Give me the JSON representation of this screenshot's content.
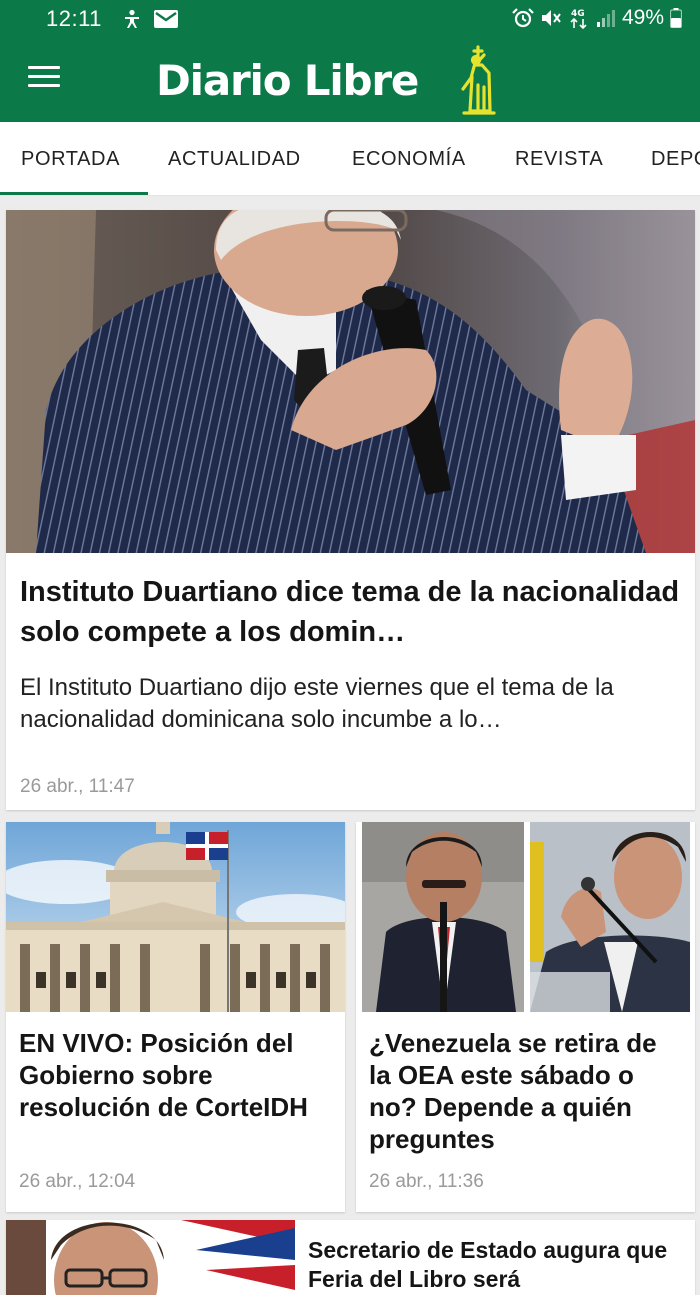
{
  "status_bar": {
    "time": "12:11",
    "battery": "49%",
    "network": "4G",
    "left_icons": [
      "accessibility-icon",
      "gmail-icon"
    ],
    "right_icons": [
      "alarm-icon",
      "mute-icon",
      "network-4g-icon",
      "signal-icon",
      "battery-icon"
    ]
  },
  "app_bar": {
    "brand": "Diario Libre",
    "brand_color": "#0c7a48",
    "accent": "#e6e32e"
  },
  "tabs": [
    {
      "label": "PORTADA",
      "active": true
    },
    {
      "label": "ACTUALIDAD",
      "active": false
    },
    {
      "label": "ECONOMÍA",
      "active": false
    },
    {
      "label": "REVISTA",
      "active": false
    },
    {
      "label": "DEPO",
      "active": false
    }
  ],
  "articles": {
    "hero": {
      "title": "Instituto Duartiano dice tema de la nacionalidad solo compete a los domin…",
      "summary": "El Instituto Duartiano dijo este viernes que el tema de la nacionalidad dominicana solo incumbe a lo…",
      "date": "26 abr., 11:47"
    },
    "left": {
      "title": "EN VIVO: Posición del Gobierno sobre resolución de CorteIDH",
      "date": "26 abr., 12:04"
    },
    "right": {
      "title": "¿Venezuela se retira de la OEA este sábado o no? Depende a quién preguntes",
      "date": "26 abr., 11:36"
    },
    "list": {
      "title": "Secretario de Estado augura que Feria del Libro será"
    }
  }
}
